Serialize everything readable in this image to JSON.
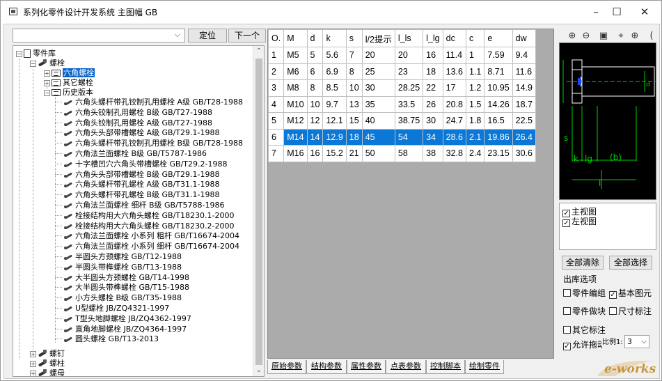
{
  "window": {
    "title": "系列化零件设计开发系统 主图幅 GB",
    "minimize": "–",
    "maximize": "☐",
    "close": "✕"
  },
  "search": {
    "value": "",
    "locate_button": "定位",
    "next_button": "下一个"
  },
  "tree": {
    "root": "零件库",
    "bolt_category": "螺栓",
    "hex_bolt": "六角螺栓",
    "other_bolt": "其它螺栓",
    "history": "历史版本",
    "history_items": [
      "六角头螺杆带孔铰制孔用螺栓 A级 GB/T28-1988",
      "六角头铰制孔用螺栓 B级 GB/T27-1988",
      "六角头铰制孔用螺栓 A级 GB/T27-1988",
      "六角头头部带槽螺栓 A级 GB/T29.1-1988",
      "六角头螺杆带孔铰制孔用螺栓 B级 GB/T28-1988",
      "六角法兰面螺栓 B级 GB/T5787-1986",
      "十字槽凹穴六角头带槽螺栓 GB/T29.2-1988",
      "六角头头部带槽螺栓 B级 GB/T29.1-1988",
      "六角头螺杆带孔螺栓 A级 GB/T31.1-1988",
      "六角头螺杆带孔螺栓 B级 GB/T31.1-1988",
      "六角法兰面螺栓 细杆 B级 GB/T5788-1986",
      "栓接结构用大六角头螺栓 GB/T18230.1-2000",
      "栓接结构用大六角头螺栓 GB/T18230.2-2000",
      "六角法兰面螺栓 小系列 粗杆 GB/T16674-2004",
      "六角法兰面螺栓 小系列 细杆 GB/T16674-2004",
      "半圆头方颈螺栓 GB/T12-1988",
      "半圆头带榫螺栓 GB/T13-1988",
      "大半圆头方颈螺栓 GB/T14-1998",
      "大半圆头带榫螺栓 GB/T15-1988",
      "小方头螺栓 B级 GB/T35-1988",
      "U型螺栓 JB/ZQ4321-1997",
      "T型头地脚螺栓 JB/ZQ4362-1997",
      "直角地脚螺栓 JB/ZQ4364-1997",
      "圆头螺栓 GB/T13-2013"
    ],
    "screw_category": "螺钉",
    "stud_category": "螺柱",
    "nut_category": "螺母"
  },
  "table": {
    "headers": [
      "O.",
      "M",
      "d",
      "k",
      "s",
      "l/2提示",
      "l_ls",
      "l_lg",
      "dc",
      "c",
      "e",
      "dw"
    ],
    "rows": [
      [
        "1",
        "M5",
        "5",
        "5.6",
        "7",
        "20",
        "20",
        "16",
        "11.4",
        "1",
        "7.59",
        "9.4"
      ],
      [
        "2",
        "M6",
        "6",
        "6.9",
        "8",
        "25",
        "23",
        "18",
        "13.6",
        "1.1",
        "8.71",
        "11.6"
      ],
      [
        "3",
        "M8",
        "8",
        "8.5",
        "10",
        "30",
        "28.25",
        "22",
        "17",
        "1.2",
        "10.95",
        "14.9"
      ],
      [
        "4",
        "M10",
        "10",
        "9.7",
        "13",
        "35",
        "33.5",
        "26",
        "20.8",
        "1.5",
        "14.26",
        "18.7"
      ],
      [
        "5",
        "M12",
        "12",
        "12.1",
        "15",
        "40",
        "38.75",
        "30",
        "24.7",
        "1.8",
        "16.5",
        "22.5"
      ],
      [
        "6",
        "M14",
        "14",
        "12.9",
        "18",
        "45",
        "54",
        "34",
        "28.6",
        "2.1",
        "19.86",
        "26.4"
      ],
      [
        "7",
        "M16",
        "16",
        "15.2",
        "21",
        "50",
        "58",
        "38",
        "32.8",
        "2.4",
        "23.15",
        "30.6"
      ]
    ],
    "selected_row": 6
  },
  "tabs": [
    "原始参数",
    "结构参数",
    "属性参数",
    "点表参数",
    "控制脚本",
    "绘制零件"
  ],
  "views": {
    "main_view": "主视图",
    "left_view": "左视图"
  },
  "buttons": {
    "clear_all": "全部清除",
    "select_all": "全部选择"
  },
  "output_options": {
    "label": "出库选项",
    "part_edit": "零件编组",
    "basic_elements": "基本图元",
    "part_block": "零件做块",
    "dim_annotate": "尺寸标注",
    "other_annotate": "其它标注",
    "allow_drag": "允许拖动",
    "scale_label": "比例1:",
    "scale_value": "3"
  },
  "preview_labels": {
    "lg": "lg",
    "b": "(b)",
    "k": "k",
    "l": "l",
    "s": "s",
    "d": "d"
  },
  "logo": "e-works",
  "colors": {
    "selection": "#0a64c8",
    "preview_bg": "#000000",
    "preview_line": "#00ff00",
    "logo": "#c8963c"
  }
}
